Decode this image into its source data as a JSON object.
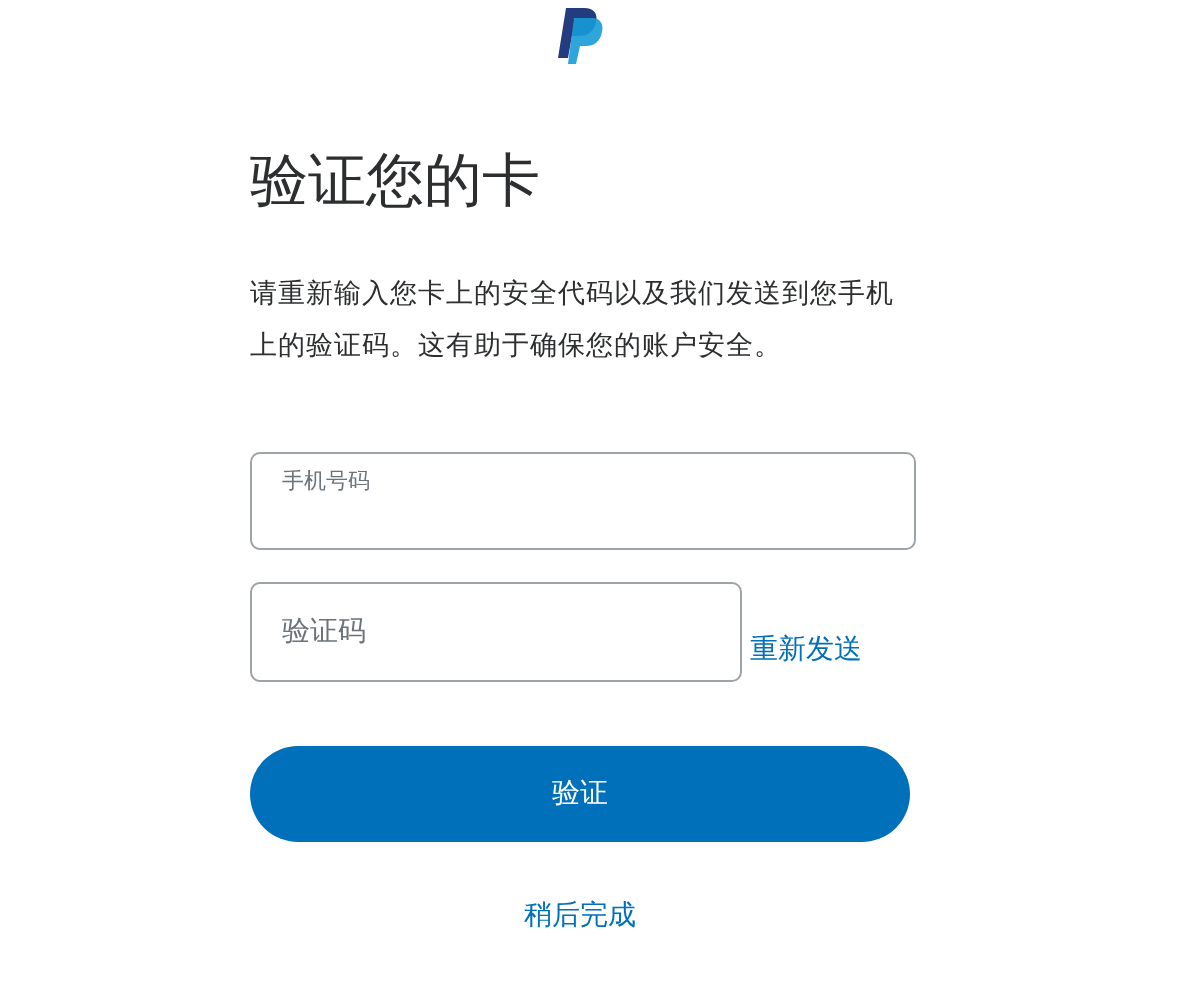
{
  "title": "验证您的卡",
  "description": "请重新输入您卡上的安全代码以及我们发送到您手机上的验证码。这有助于确保您的账户安全。",
  "phone_field": {
    "label": "手机号码"
  },
  "code_field": {
    "placeholder": "验证码"
  },
  "resend_link": "重新发送",
  "verify_button": "验证",
  "later_link": "稍后完成"
}
